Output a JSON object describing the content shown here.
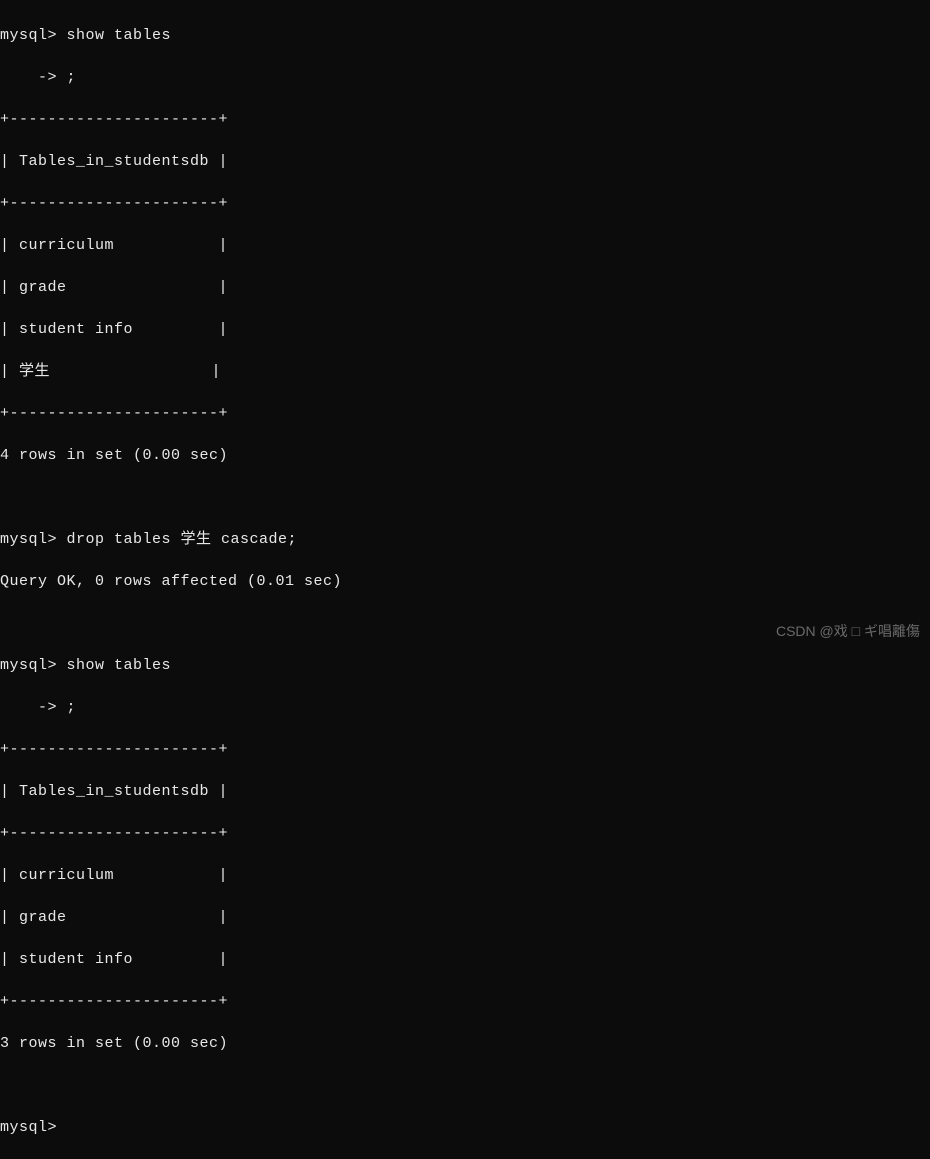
{
  "prompt": "mysql>",
  "continuation": "    ->",
  "cmd_show_tables": "show tables",
  "semicolon": ";",
  "divider": "+----------------------+",
  "header_line": "| Tables_in_studentsdb |",
  "table1_rows": {
    "r1": "| curriculum           |",
    "r2": "| grade                |",
    "r3": "| student info         |",
    "r4": "| 学生                 |"
  },
  "result1": "4 rows in set (0.00 sec)",
  "cmd_drop": "drop tables 学生 cascade;",
  "drop_result": "Query OK, 0 rows affected (0.01 sec)",
  "table2_rows": {
    "r1": "| curriculum           |",
    "r2": "| grade                |",
    "r3": "| student info         |"
  },
  "result2": "3 rows in set (0.00 sec)",
  "watermark": "CSDN @戏 □ ギ唱離傷"
}
